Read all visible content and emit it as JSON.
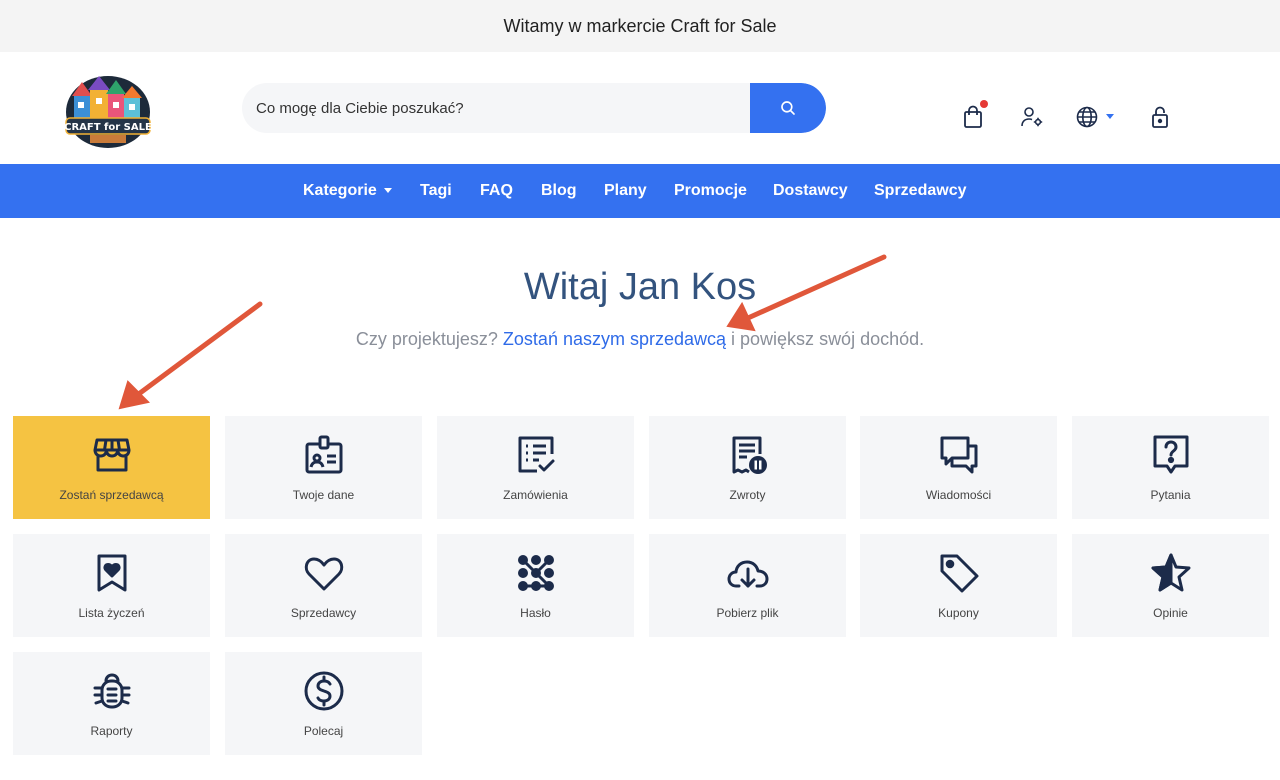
{
  "topbar": {
    "text": "Witamy w markercie Craft for Sale"
  },
  "logo": {
    "text": "CRAFT for SALE"
  },
  "search": {
    "placeholder": "Co mogę dla Ciebie poszukać?"
  },
  "nav": [
    {
      "label": "Kategorie",
      "dropdown": true
    },
    {
      "label": "Tagi"
    },
    {
      "label": "FAQ"
    },
    {
      "label": "Blog"
    },
    {
      "label": "Plany"
    },
    {
      "label": "Promocje"
    },
    {
      "label": "Dostawcy"
    },
    {
      "label": "Sprzedawcy"
    }
  ],
  "welcome": {
    "title": "Witaj Jan Kos",
    "subtitle_before": "Czy projektujesz?",
    "subtitle_link": "Zostań naszym sprzedawcą",
    "subtitle_after": "i powiększ swój dochód."
  },
  "tiles": [
    {
      "label": "Zostań sprzedawcą",
      "icon": "storefront-icon",
      "active": true
    },
    {
      "label": "Twoje dane",
      "icon": "id-badge-icon"
    },
    {
      "label": "Zamówienia",
      "icon": "order-list-icon"
    },
    {
      "label": "Zwroty",
      "icon": "receipt-pause-icon"
    },
    {
      "label": "Wiadomości",
      "icon": "chat-bubbles-icon"
    },
    {
      "label": "Pytania",
      "icon": "question-icon"
    },
    {
      "label": "Lista życzeń",
      "icon": "bookmark-heart-icon"
    },
    {
      "label": "Sprzedawcy",
      "icon": "heart-icon"
    },
    {
      "label": "Hasło",
      "icon": "pattern-lock-icon"
    },
    {
      "label": "Pobierz plik",
      "icon": "cloud-download-icon"
    },
    {
      "label": "Kupony",
      "icon": "tag-icon"
    },
    {
      "label": "Opinie",
      "icon": "star-icon"
    },
    {
      "label": "Raporty",
      "icon": "bug-icon"
    },
    {
      "label": "Polecaj",
      "icon": "dollar-circle-icon"
    }
  ],
  "colors": {
    "accent": "#3471f0",
    "active_tile": "#f5c342",
    "icon": "#1c2b4a",
    "annotation_arrow": "#e0573a"
  }
}
